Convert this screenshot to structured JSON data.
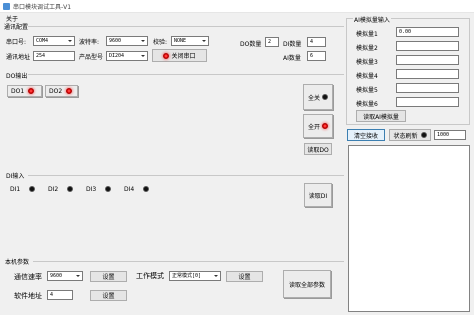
{
  "window": {
    "title": "串口模块调试工具-V1"
  },
  "menu": {
    "about": "关于"
  },
  "comm": {
    "group_title": "通讯配置",
    "port_label": "串口号:",
    "port_value": "COM4",
    "baud_label": "波特率:",
    "baud_value": "9600",
    "parity_label": "校验:",
    "parity_value": "NONE",
    "addr_label": "通讯地址",
    "addr_value": "254",
    "model_label": "产品型号",
    "model_value": "DI204",
    "close_port_label": "关闭串口",
    "do_count_label": "DO数量",
    "do_count_value": "2",
    "di_count_label": "DI数量",
    "di_count_value": "4",
    "ai_count_label": "AI数量",
    "ai_count_value": "6"
  },
  "do_output": {
    "group_title": "DO输出",
    "items": [
      {
        "label": "DO1",
        "state": "on"
      },
      {
        "label": "DO2",
        "state": "on"
      }
    ],
    "all_off_label": "全关",
    "all_on_label": "全开",
    "read_label": "读取DO"
  },
  "di_input": {
    "group_title": "DI输入",
    "items": [
      {
        "label": "DI1",
        "state": "off"
      },
      {
        "label": "DI2",
        "state": "off"
      },
      {
        "label": "DI3",
        "state": "off"
      },
      {
        "label": "DI4",
        "state": "off"
      }
    ],
    "read_label": "读取DI"
  },
  "params": {
    "group_title": "本机参数",
    "baud_label": "通信速率",
    "baud_value": "9600",
    "set1_label": "设置",
    "mode_label": "工作模式",
    "mode_value": "正常模式[0]",
    "set2_label": "设置",
    "addr_label": "软件地址",
    "addr_value": "4",
    "set3_label": "设置",
    "read_all_label": "读取全部参数"
  },
  "ai_input": {
    "group_title": "AI模拟量输入",
    "items": [
      {
        "label": "模拟量1",
        "value": "0.00"
      },
      {
        "label": "模拟量2",
        "value": ""
      },
      {
        "label": "模拟量3",
        "value": ""
      },
      {
        "label": "模拟量4",
        "value": ""
      },
      {
        "label": "模拟量5",
        "value": ""
      },
      {
        "label": "模拟量6",
        "value": ""
      }
    ],
    "read_label": "读取AI模拟量"
  },
  "bottom_right": {
    "clear_label": "清空接收",
    "refresh_label": "状态刷新",
    "interval_value": "1000"
  },
  "colors": {
    "led_on": "#ff0000",
    "led_off": "#111111",
    "highlight_border": "#3c7fb1"
  }
}
